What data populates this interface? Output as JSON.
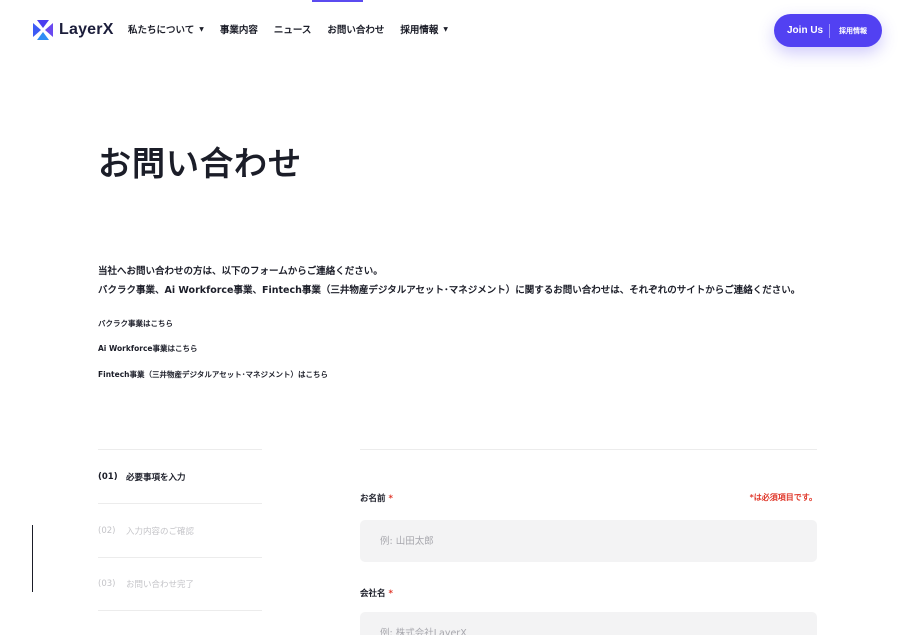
{
  "brand": {
    "name": "LayerX",
    "colors": {
      "accent": "#5241f2",
      "required": "#e0392c"
    }
  },
  "nav": {
    "items": [
      {
        "label": "私たちについて",
        "has_dropdown": true
      },
      {
        "label": "事業内容",
        "has_dropdown": false
      },
      {
        "label": "ニュース",
        "has_dropdown": false
      },
      {
        "label": "お問い合わせ",
        "has_dropdown": false,
        "active": true
      },
      {
        "label": "採用情報",
        "has_dropdown": true
      }
    ],
    "cta": {
      "main": "Join Us",
      "sub": "採用情報"
    }
  },
  "page": {
    "title": "お問い合わせ",
    "intro": [
      "当社へお問い合わせの方は、以下のフォームからご連絡ください。",
      "バクラク事業、Ai Workforce事業、Fintech事業（三井物産デジタルアセット･マネジメント）に関するお問い合わせは、それぞれのサイトからご連絡ください。"
    ],
    "links": [
      "バクラク事業はこちら",
      "Ai Workforce事業はこちら",
      "Fintech事業（三井物産デジタルアセット･マネジメント）はこちら"
    ]
  },
  "steps": [
    {
      "num": "(01)",
      "label": "必要事項を入力",
      "active": true
    },
    {
      "num": "(02)",
      "label": "入力内容のご確認",
      "active": false
    },
    {
      "num": "(03)",
      "label": "お問い合わせ完了",
      "active": false
    }
  ],
  "form": {
    "required_note": "*は必須項目です。",
    "required_mark": "*",
    "fields": [
      {
        "label": "お名前",
        "placeholder": "例: 山田太郎"
      },
      {
        "label": "会社名",
        "placeholder": "例: 株式会社LayerX"
      }
    ]
  }
}
